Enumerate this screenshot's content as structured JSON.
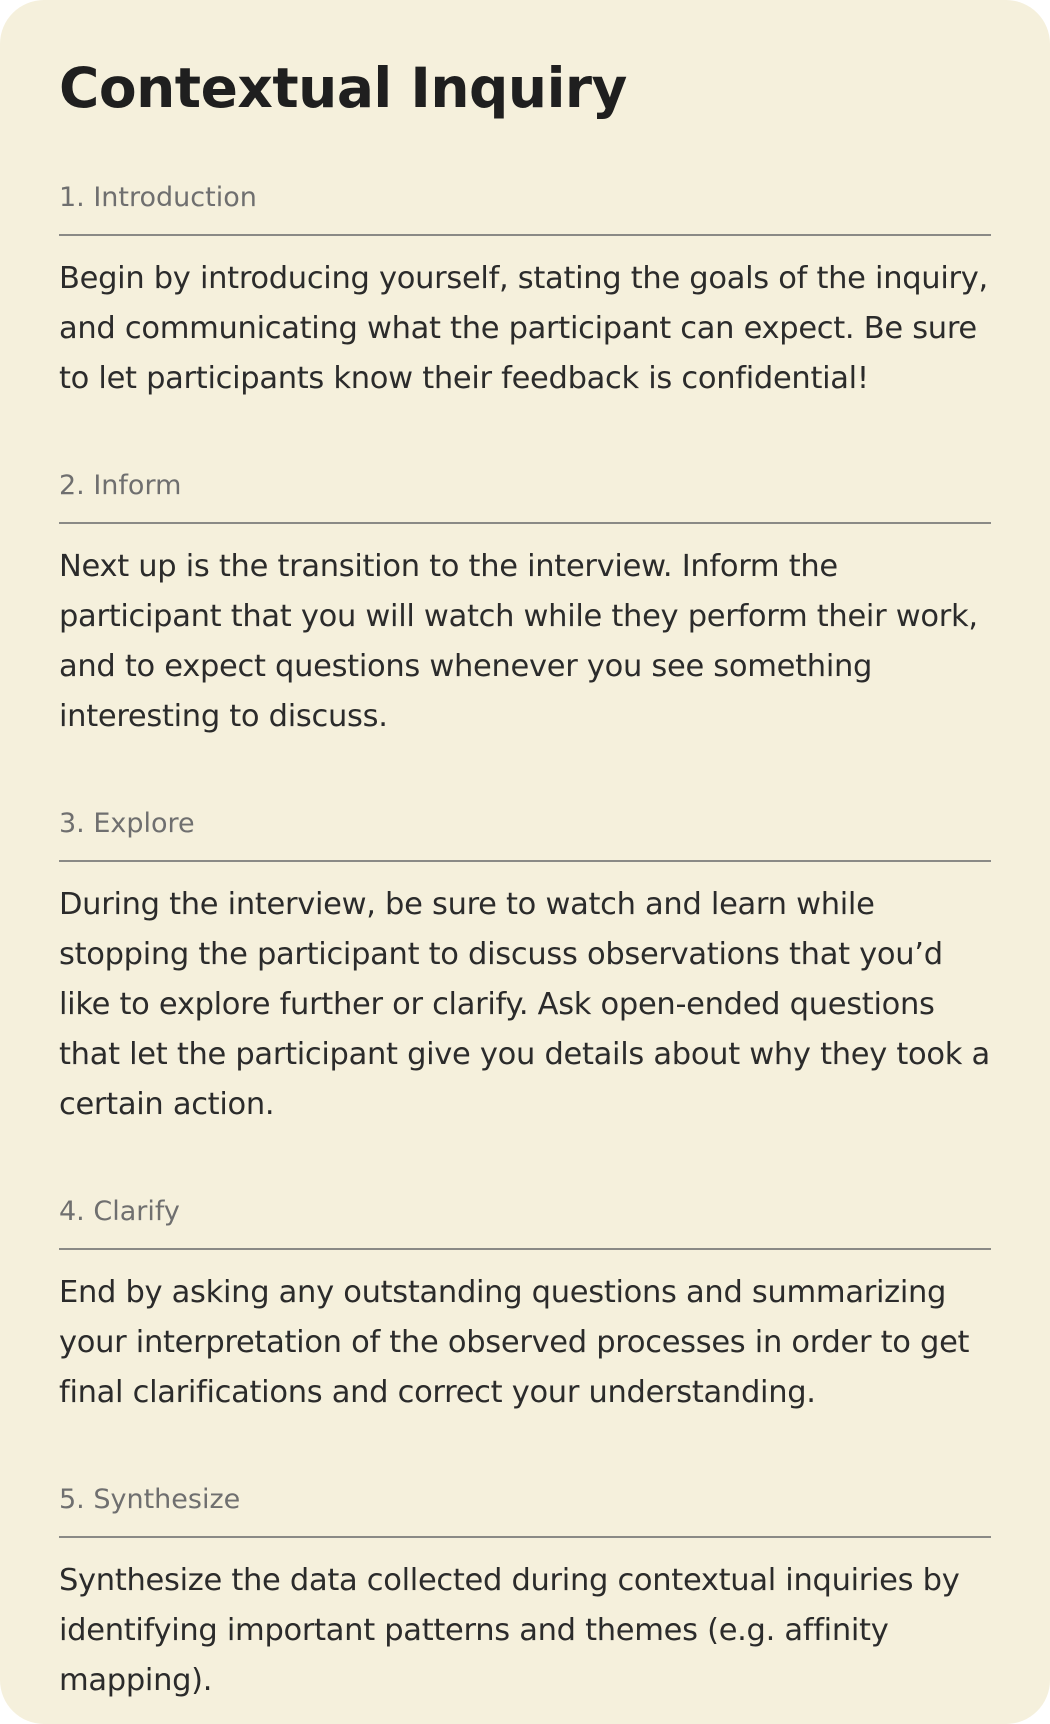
{
  "page": {
    "title": "Contextual Inquiry"
  },
  "sections": [
    {
      "label": "1. Introduction",
      "body": "Begin by introducing yourself, stating the goals of the inquiry, and communicating what the participant can expect. Be sure to let participants know their feedback is confidential!"
    },
    {
      "label": "2. Inform",
      "body": "Next up is the transition to the interview. Inform the participant that you will watch while they perform their work, and to expect questions whenever you see something interesting to discuss."
    },
    {
      "label": "3. Explore",
      "body": "During the interview, be sure to watch and learn while stopping the participant to discuss observations that you’d like to explore further or clarify. Ask open-ended questions that let the participant give you details about why they took a certain action."
    },
    {
      "label": "4. Clarify",
      "body": "End by asking any outstanding questions and summarizing your interpretation of the observed processes in order to get final clarifications and correct your understanding."
    },
    {
      "label": "5. Synthesize",
      "body": "Synthesize the data collected during contextual inquiries by identifying important patterns and themes (e.g. affinity mapping)."
    }
  ],
  "colors": {
    "background": "#f5f0dc",
    "title": "#1f1f1f",
    "label": "#6f6f6f",
    "divider": "#8a8a86",
    "body": "#2b2b2b"
  }
}
